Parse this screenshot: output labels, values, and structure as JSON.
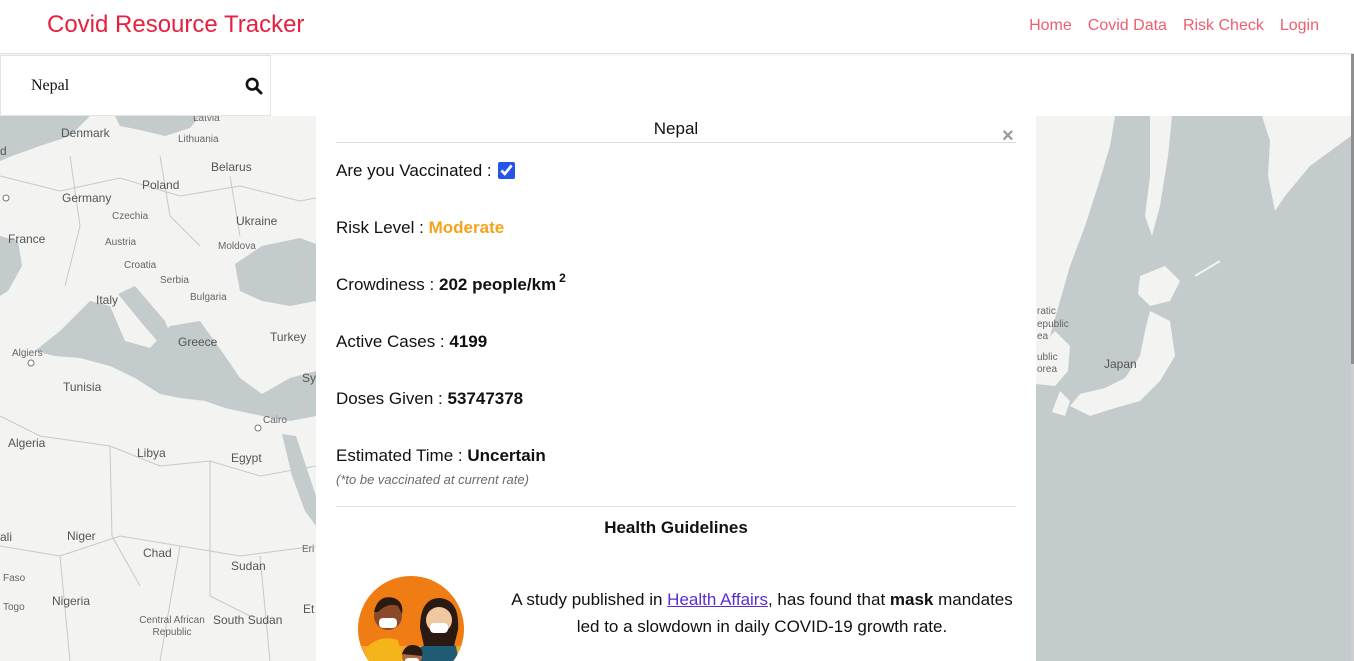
{
  "navbar": {
    "brand": "Covid Resource Tracker",
    "links": [
      "Home",
      "Covid Data",
      "Risk Check",
      "Login"
    ]
  },
  "search": {
    "value": "Nepal",
    "icon": "search-icon"
  },
  "map": {
    "labels": [
      "Latvia",
      "Denmark",
      "Lithuania",
      "Belarus",
      "Poland",
      "Germany",
      "Czechia",
      "Ukraine",
      "France",
      "Austria",
      "Moldova",
      "Croatia",
      "Serbia",
      "Italy",
      "Bulgaria",
      "Turkey",
      "Greece",
      "Algiers",
      "Tunisia",
      "Sy",
      "Cairo",
      "Algeria",
      "Libya",
      "Egypt",
      "Niger",
      "Chad",
      "Sudan",
      "Eri",
      "ali",
      "Faso",
      "Nigeria",
      "Togo",
      "Central African Republic",
      "South Sudan",
      "Et",
      "d",
      "ratic",
      "epublic",
      "ea",
      "ublic",
      "orea",
      "Japan"
    ]
  },
  "modal": {
    "title": "Nepal",
    "close_symbol": "×",
    "vaccinated_label": "Are you Vaccinated :",
    "vaccinated": true,
    "risk_label": "Risk Level :",
    "risk_value": "Moderate",
    "crowdiness_label": "Crowdiness :",
    "crowdiness_value": "202 people/km",
    "crowdiness_sup": "2",
    "active_label": "Active Cases :",
    "active_value": "4199",
    "doses_label": "Doses Given :",
    "doses_value": "53747378",
    "estimated_label": "Estimated Time :",
    "estimated_value": "Uncertain",
    "estimated_note": "(*to be vaccinated at current rate)",
    "guidelines_title": "Health Guidelines",
    "study_prefix": "A study published in ",
    "study_link": "Health Affairs",
    "study_mid": ", has found that ",
    "study_bold": "mask",
    "study_suffix": " mandates led to a slowdown in daily COVID-19 growth rate."
  },
  "colors": {
    "brand": "#e8203f",
    "nav_link": "#ee5e6e",
    "risk_moderate": "#f5a31a",
    "water": "#c3cbcd",
    "land": "#f3f3f1"
  }
}
